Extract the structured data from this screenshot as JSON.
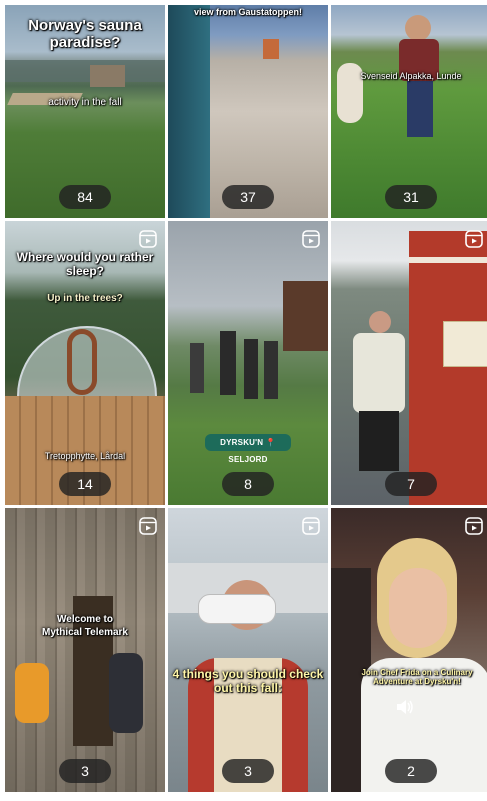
{
  "tiles": [
    {
      "caption": "Norway's sauna paradise?",
      "caption2": "activity in the fall",
      "count": "84",
      "reel": false
    },
    {
      "caption": "view from Gaustatoppen!",
      "count": "37",
      "reel": false
    },
    {
      "caption": "Svenseid Alpakka, Lunde",
      "count": "31",
      "reel": false
    },
    {
      "caption": "Where would you rather sleep?",
      "caption2": "Up in the trees?",
      "caption3": "Tretopphytte, Lårdal",
      "count": "14",
      "reel": true
    },
    {
      "label": "DYRSKU'N 📍SELJORD",
      "count": "8",
      "reel": true
    },
    {
      "count": "7",
      "reel": true
    },
    {
      "caption": "Welcome to",
      "caption2": "Mythical Telemark",
      "count": "3",
      "reel": true
    },
    {
      "caption": "4 things you should check out this fall:",
      "count": "3",
      "reel": true
    },
    {
      "caption": "Join Chef Frida on a Culinary Adventure at Dyrsku'n!",
      "count": "2",
      "reel": true
    }
  ],
  "colors": {
    "count_pill": "#222222",
    "label_pill": "#1d6b5a"
  }
}
